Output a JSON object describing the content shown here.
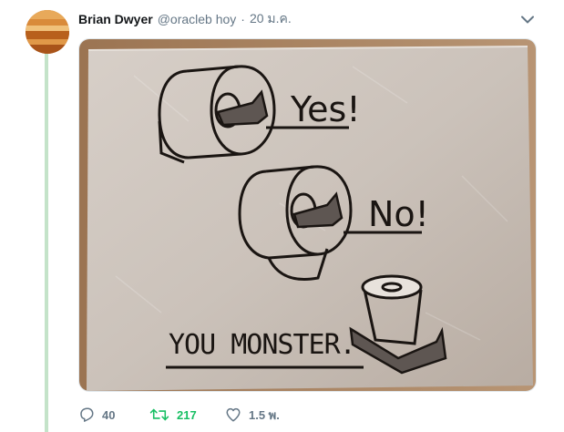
{
  "tweet": {
    "author": {
      "display_name": "Brian Dwyer",
      "handle": "@oracleb hoy"
    },
    "separator": "·",
    "timestamp": "20 ม.ค.",
    "media": {
      "texts": {
        "yes": "Yes!",
        "no": "No!",
        "monster": "YOU MONSTER."
      }
    },
    "actions": {
      "replies": "40",
      "retweets": "217",
      "likes": "1.5 พ."
    },
    "icons": {
      "caret": "chevron-down-icon",
      "reply": "reply-icon",
      "retweet": "retweet-icon",
      "like": "heart-icon"
    }
  },
  "colors": {
    "thread_line": "#c4e3c9",
    "text_primary": "#14171a",
    "text_secondary": "#657786"
  }
}
